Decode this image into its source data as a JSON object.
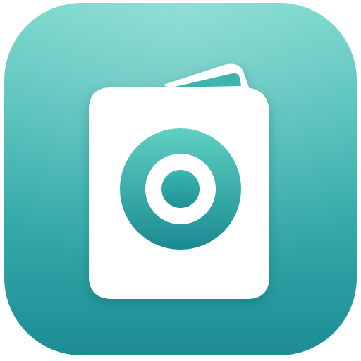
{
  "icon": {
    "name": "app-icon",
    "symbol": "wallet-camera-icon",
    "colors": {
      "background_top": "#6FD4C8",
      "background_bottom": "#1E8E97",
      "glyph": "#FFFFFF",
      "lens_top": "#62CFC0",
      "lens_bottom": "#1A8B93",
      "shadow": "#0E5E66"
    }
  }
}
